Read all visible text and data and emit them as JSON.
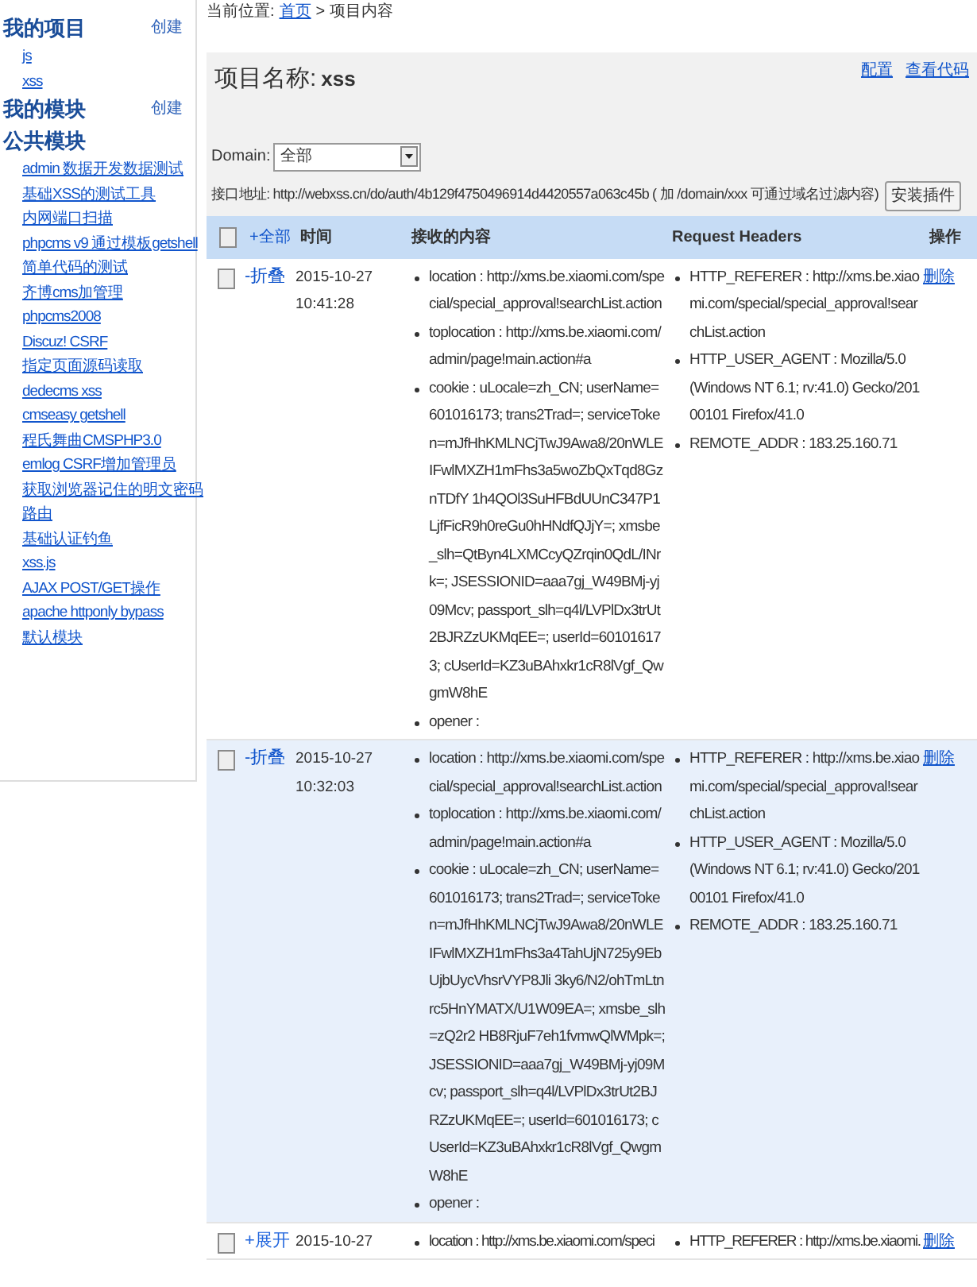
{
  "sidebar": {
    "sections": [
      {
        "title": "我的项目",
        "action": "创建",
        "items": [
          "js",
          "xss"
        ]
      },
      {
        "title": "我的模块",
        "action": "创建"
      },
      {
        "title": "公共模块",
        "items": [
          "admin 数据开发数据测试",
          "基础XSS的测试工具",
          "内网端口扫描",
          "phpcms v9 通过模板getshell",
          "简单代码的测试",
          "齐博cms加管理",
          "phpcms2008",
          "Discuz! CSRF",
          "指定页面源码读取",
          "dedecms xss",
          "cmseasy getshell",
          "程氏舞曲CMSPHP3.0",
          "emlog CSRF增加管理员",
          "获取浏览器记住的明文密码",
          "路由",
          "基础认证钓鱼",
          "xss.js",
          "AJAX POST/GET操作",
          "apache httponly bypass",
          "默认模块"
        ]
      }
    ]
  },
  "breadcrumb": {
    "label": "当前位置:",
    "link": "首页",
    "current": "> 项目内容"
  },
  "project": {
    "label": "项目名称:",
    "name": "xss",
    "links": [
      "配置",
      "查看代码"
    ]
  },
  "domain": {
    "label": "Domain:",
    "value": "全部"
  },
  "api": {
    "label": "接口地址:",
    "url": "http://webxss.cn/do/auth/4b129f4750496914d4420557a063c45b",
    "note": "( 加 /domain/xxx 可通过域名过滤内容)",
    "button": "安装插件"
  },
  "table": {
    "header_checked": false,
    "toggle_all": "+全部",
    "columns": [
      "时间",
      "接收的内容",
      "Request Headers",
      "操作"
    ],
    "rows": [
      {
        "checked": false,
        "selected": false,
        "expanded": true,
        "toggle": "-折叠",
        "date": "2015-10-27",
        "time": "10:41:28",
        "content": [
          "location : http://xms.be.xiaomi.com/special/special_approval!searchList.action",
          "toplocation : http://xms.be.xiaomi.com/admin/page!main.action#a",
          "cookie : uLocale=zh_CN; userName=601016173; trans2Trad=; serviceToken=mJfHhKMLNCjTwJ9Awa8/20nWLEIFwlMXZH1mFhs3a5woZbQxTqd8GznTDfY 1h4QOl3SuHFBdUUnC347P1LjfFicR9h0reGu0hHNdfQJjY=; xmsbe_slh=QtByn4LXMCcyQZrqin0QdL/INrk=; JSESSIONID=aaa7gj_W49BMj-yj09Mcv; passport_slh=q4l/LVPlDx3trUt2BJRZzUKMqEE=; userId=601016173; cUserId=KZ3uBAhxkr1cR8lVgf_QwgmW8hE",
          "opener :"
        ],
        "headers": [
          "HTTP_REFERER : http://xms.be.xiaomi.com/special/special_approval!searchList.action",
          "HTTP_USER_AGENT : Mozilla/5.0 (Windows NT 6.1; rv:41.0) Gecko/20100101 Firefox/41.0",
          "REMOTE_ADDR : 183.25.160.71"
        ],
        "action": "删除"
      },
      {
        "checked": false,
        "selected": true,
        "expanded": true,
        "toggle": "-折叠",
        "date": "2015-10-27",
        "time": "10:32:03",
        "content": [
          "location : http://xms.be.xiaomi.com/special/special_approval!searchList.action",
          "toplocation : http://xms.be.xiaomi.com/admin/page!main.action#a",
          "cookie : uLocale=zh_CN; userName=601016173; trans2Trad=; serviceToken=mJfHhKMLNCjTwJ9Awa8/20nWLEIFwlMXZH1mFhs3a4TahUjN725y9EbUjbUycVhsrVYP8Jli 3ky6/N2/ohTmLtnrc5HnYMATX/U1W09EA=; xmsbe_slh=zQ2r2 HB8RjuF7eh1fvmwQlWMpk=; JSESSIONID=aaa7gj_W49BMj-yj09Mcv; passport_slh=q4l/LVPlDx3trUt2BJRZzUKMqEE=; userId=601016173; cUserId=KZ3uBAhxkr1cR8lVgf_QwgmW8hE",
          "opener :"
        ],
        "headers": [
          "HTTP_REFERER : http://xms.be.xiaomi.com/special/special_approval!searchList.action",
          "HTTP_USER_AGENT : Mozilla/5.0 (Windows NT 6.1; rv:41.0) Gecko/20100101 Firefox/41.0",
          "REMOTE_ADDR : 183.25.160.71"
        ],
        "action": "删除"
      },
      {
        "checked": false,
        "selected": false,
        "expanded": false,
        "toggle": "+展开",
        "date": "2015-10-27",
        "content": [
          "location : http://xms.be.xiaomi.com/speci"
        ],
        "headers": [
          "HTTP_REFERER : http://xms.be.xiaomi."
        ],
        "action": "删除"
      }
    ]
  }
}
